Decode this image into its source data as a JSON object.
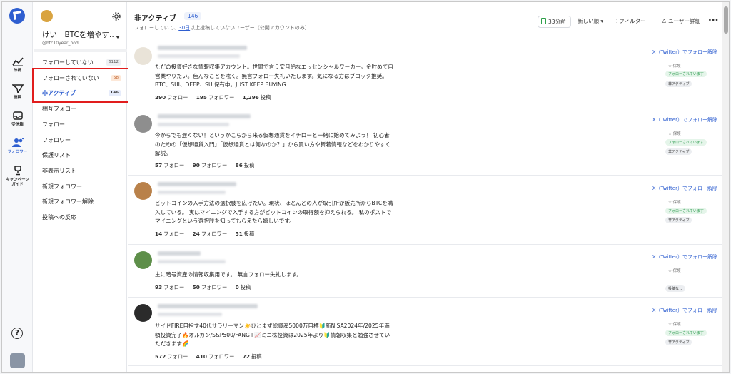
{
  "rail": {
    "items": [
      {
        "label": "分析"
      },
      {
        "label": "投稿"
      },
      {
        "label": "受信箱"
      },
      {
        "label": "フォロワー"
      },
      {
        "label": "キャンペーン"
      },
      {
        "label": "ガイド"
      }
    ],
    "help": "?"
  },
  "sidebar": {
    "username": "けい｜BTCを増やす…",
    "handle": "@btc10year_hodl",
    "items": [
      {
        "label": "フォローしていない",
        "count": "6112"
      },
      {
        "label": "フォローされていない",
        "count": "58"
      },
      {
        "label": "非アクティブ",
        "count": "146"
      },
      {
        "label": "相互フォロー"
      },
      {
        "label": "フォロー"
      },
      {
        "label": "フォロワー"
      },
      {
        "label": "保護リスト"
      },
      {
        "label": "非表示リスト"
      },
      {
        "label": "新規フォロワー"
      },
      {
        "label": "新規フォロワー解除"
      },
      {
        "label": "投稿への反応"
      }
    ]
  },
  "header": {
    "title": "非アクティブ",
    "count": "146",
    "subtitle_pre": "フォローしていて、",
    "subtitle_link": "30日",
    "subtitle_post": "以上投稿していないユーザー（公開アカウントのみ）",
    "time": "33分前",
    "sort": "新しい順 ▾",
    "filter": "フィルター",
    "detail": "ユーザー詳細",
    "more": "•••"
  },
  "colors": {
    "accent": "#2f5fd0",
    "highlight": "#e11d1d",
    "green": "#2a9a4c"
  },
  "cards": [
    {
      "bio": "ただの投資好きな情報収集アカウント。世間で言う安月給なエッセンシャルワーカー。金貯めて自営業やりたい。色んなことを呟く。無言フォロー失礼いたします。気になる方はブロック推奨。BTC、SUI、DEEP、SUI保有中。JUST KEEP BUYING",
      "follow": "290",
      "follow_label": "フォロー",
      "followers": "195",
      "followers_label": "フォロワー",
      "posts": "1,296",
      "posts_label": "投稿",
      "unfollow": "X（Twitter）でフォロー解除",
      "protect": "☆ 保護",
      "badge1": "フォローされています",
      "badge2": "非アクティブ"
    },
    {
      "bio": "今からでも遅くない！というかこらから来る仮想通貨をイチローと一緒に始めてみよう！ 初心者のための「仮想通貨入門」「仮想通貨とは何なのか？」から買い方や新着情報などをわかりやすく解説。",
      "follow": "57",
      "follow_label": "フォロー",
      "followers": "90",
      "followers_label": "フォロワー",
      "posts": "86",
      "posts_label": "投稿",
      "unfollow": "X（Twitter）でフォロー解除",
      "protect": "☆ 保護",
      "badge1": "フォローされています",
      "badge2": "非アクティブ"
    },
    {
      "bio": "ビットコインの入手方法の選択肢を広げたい。現状、ほとんどの人が取引所か販売所からBTCを購入している。 実はマイニングで入手する方がビットコインの取得額を抑えられる。 私のポストでマイニングという選択肢を知ってもらえたら嬉しいです。",
      "follow": "14",
      "follow_label": "フォロー",
      "followers": "24",
      "followers_label": "フォロワー",
      "posts": "51",
      "posts_label": "投稿",
      "unfollow": "X（Twitter）でフォロー解除",
      "protect": "☆ 保護",
      "badge1": "フォローされています",
      "badge2": "非アクティブ"
    },
    {
      "bio": "主に暗号資産の情報収集用です。 無言フォロー失礼します。",
      "follow": "93",
      "follow_label": "フォロー",
      "followers": "50",
      "followers_label": "フォロワー",
      "posts": "0",
      "posts_label": "投稿",
      "unfollow": "X（Twitter）でフォロー解除",
      "protect": "☆ 保護",
      "badge1": "",
      "badge2": "投稿なし"
    },
    {
      "bio": "サイドFIRE目指す40代サラリーマン☀️ひとまず総資産5000万目標🔰新NISA2024年/2025年満額投資完了🔥オルカン/S&P500/FANG+📈ミニ株投資は2025年より🔰情報収集と勉強させていただきます🌈",
      "follow": "572",
      "follow_label": "フォロー",
      "followers": "410",
      "followers_label": "フォロワー",
      "posts": "72",
      "posts_label": "投稿",
      "unfollow": "X（Twitter）でフォロー解除",
      "protect": "☆ 保護",
      "badge1": "フォローされています",
      "badge2": "非アクティブ"
    }
  ]
}
